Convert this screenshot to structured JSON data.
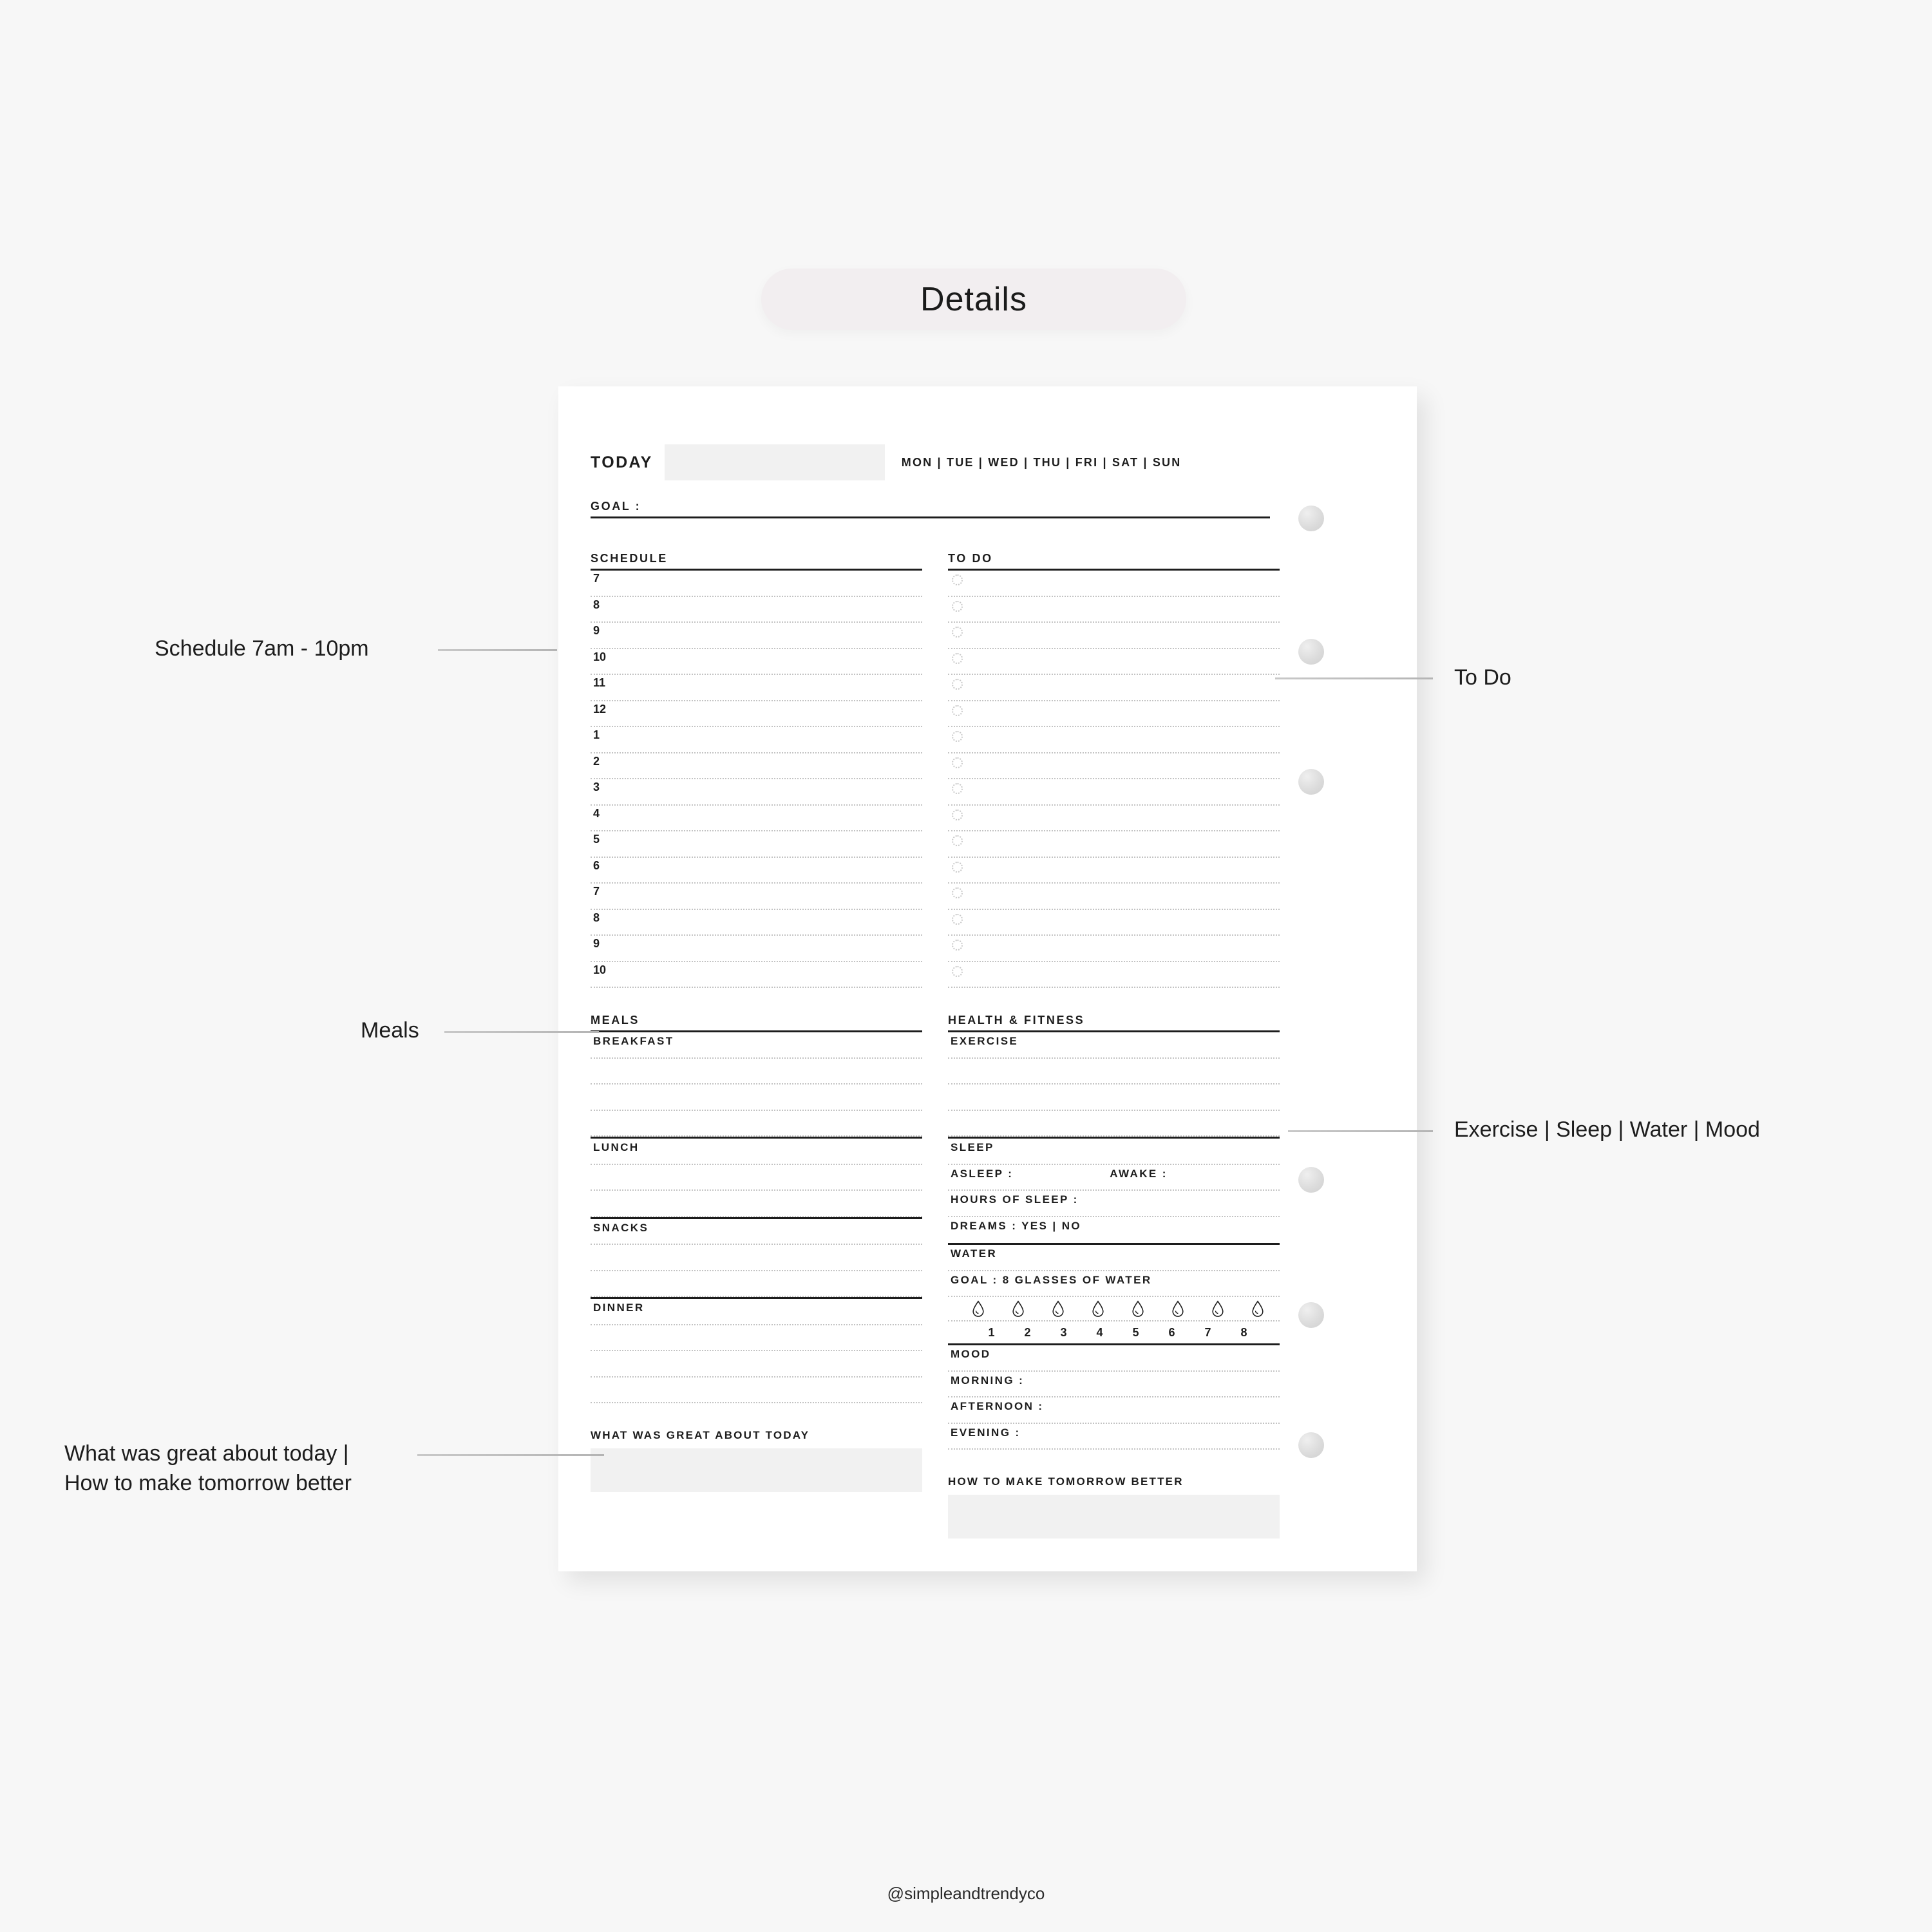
{
  "header": {
    "title": "Details"
  },
  "footer": {
    "handle": "@simpleandtrendyco"
  },
  "planner": {
    "today_label": "TODAY",
    "today_value": "",
    "days": "MON | TUE | WED | THU | FRI | SAT | SUN",
    "goal_label": "GOAL :",
    "schedule": {
      "title": "SCHEDULE",
      "hours": [
        "7",
        "8",
        "9",
        "10",
        "11",
        "12",
        "1",
        "2",
        "3",
        "4",
        "5",
        "6",
        "7",
        "8",
        "9",
        "10"
      ]
    },
    "todo": {
      "title": "TO DO",
      "item_count": 16,
      "checkbox_icon": "circle-outline-icon"
    },
    "meals": {
      "title": "MEALS",
      "breakfast": "BREAKFAST",
      "lunch": "LUNCH",
      "snacks": "SNACKS",
      "dinner": "DINNER"
    },
    "health": {
      "title": "HEALTH & FITNESS",
      "exercise": "EXERCISE",
      "sleep": "SLEEP",
      "asleep": "ASLEEP :",
      "awake": "AWAKE :",
      "hours_of_sleep": "HOURS OF SLEEP :",
      "dreams": "DREAMS : YES | NO",
      "water": "WATER",
      "water_goal": "GOAL : 8 GLASSES OF WATER",
      "water_icon": "water-drop-icon",
      "water_numbers": [
        "1",
        "2",
        "3",
        "4",
        "5",
        "6",
        "7",
        "8"
      ],
      "mood": "MOOD",
      "morning": "MORNING :",
      "afternoon": "AFTERNOON :",
      "evening": "EVENING :"
    },
    "notes": {
      "great_today": "WHAT WAS GREAT ABOUT TODAY",
      "tomorrow_better": "HOW TO MAKE TOMORROW BETTER"
    }
  },
  "annotations": {
    "schedule": "Schedule 7am - 10pm",
    "meals": "Meals",
    "notes_line1": "What was great about today |",
    "notes_line2": "How to make tomorrow better",
    "todo": "To Do",
    "health": "Exercise | Sleep | Water | Mood"
  }
}
